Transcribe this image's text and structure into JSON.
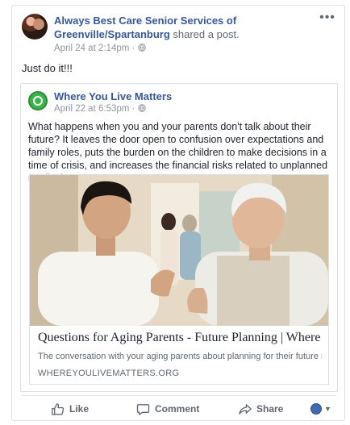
{
  "post": {
    "author": "Always Best Care Senior Services of Greenville/Spartanburg",
    "shared_text": "shared a post.",
    "timestamp": "April 24 at 2:14pm",
    "separator": "·",
    "more_icon": "•••",
    "body": "Just do it!!!"
  },
  "shared_post": {
    "author": "Where You Live Matters",
    "timestamp": "April 22 at 6:53pm",
    "separator": "·",
    "body": "What happens when you and your parents don't talk about their future? It leaves the door open to confusion over expectations and family roles, puts the burden on the children to make decisions in a time of crisis, and increases the financial risks related to unplanned medical costs."
  },
  "link_preview": {
    "title": "Questions for Aging Parents - Future Planning | Where",
    "description": "The conversation with your aging parents about planning for their future may ...",
    "domain": "WHEREYOULIVEMATTERS.ORG"
  },
  "actions": {
    "like": "Like",
    "comment": "Comment",
    "share": "Share"
  },
  "icons": {
    "more": "more-options-icon",
    "globe": "globe-icon",
    "like": "thumbs-up-icon",
    "comment": "comment-bubble-icon",
    "share": "share-arrow-icon",
    "reaction": "reaction-avatar-icon",
    "caret": "chevron-down-icon"
  },
  "colors": {
    "link_blue": "#365899",
    "meta_gray": "#90949c",
    "border": "#dddfe2",
    "brand_green": "#3bb44a"
  }
}
